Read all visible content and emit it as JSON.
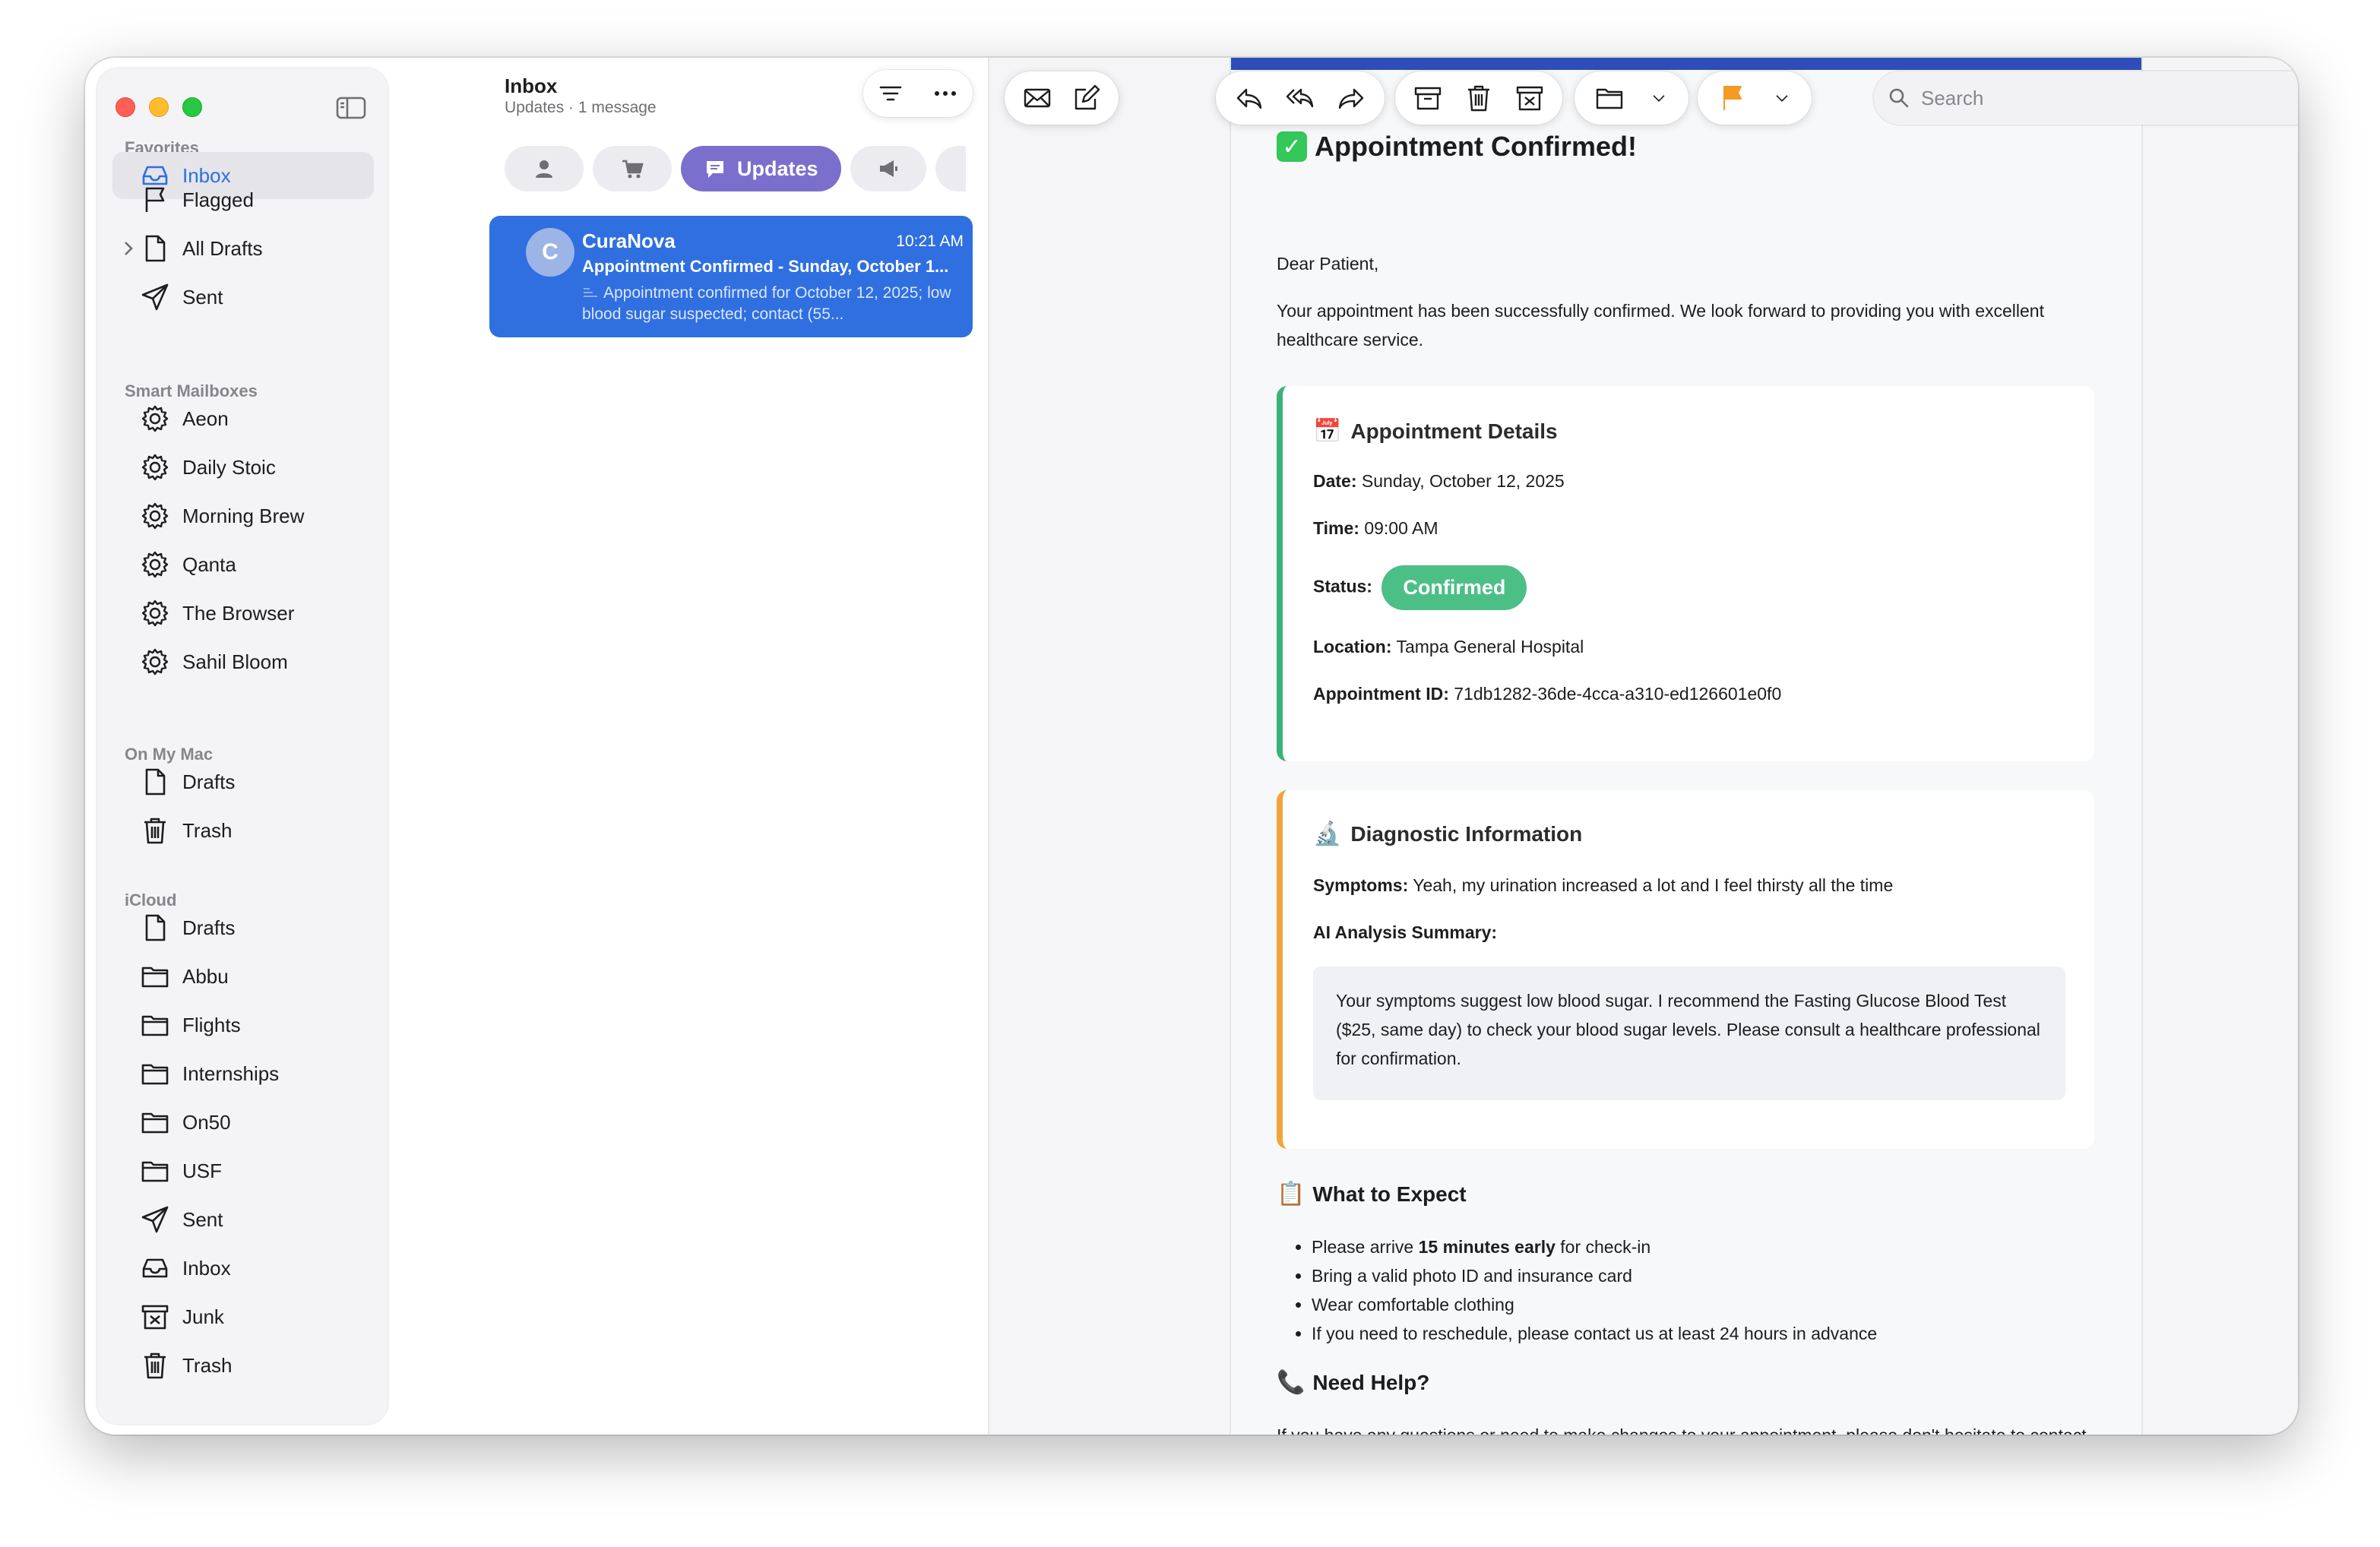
{
  "sidebar": {
    "sections": {
      "favorites": "Favorites",
      "smart": "Smart Mailboxes",
      "onmymac": "On My Mac",
      "icloud": "iCloud"
    },
    "favorites": [
      {
        "label": "Inbox",
        "icon": "inbox-icon"
      },
      {
        "label": "Flagged",
        "icon": "flag-icon"
      },
      {
        "label": "All Drafts",
        "icon": "document-icon"
      },
      {
        "label": "Sent",
        "icon": "paper-plane-icon"
      }
    ],
    "smart": [
      {
        "label": "Aeon",
        "icon": "gear-icon"
      },
      {
        "label": "Daily Stoic",
        "icon": "gear-icon"
      },
      {
        "label": "Morning Brew",
        "icon": "gear-icon"
      },
      {
        "label": "Qanta",
        "icon": "gear-icon"
      },
      {
        "label": "The Browser",
        "icon": "gear-icon"
      },
      {
        "label": "Sahil Bloom",
        "icon": "gear-icon"
      }
    ],
    "onmymac": [
      {
        "label": "Drafts",
        "icon": "document-icon"
      },
      {
        "label": "Trash",
        "icon": "trash-icon"
      }
    ],
    "icloud": [
      {
        "label": "Drafts",
        "icon": "document-icon"
      },
      {
        "label": "Abbu",
        "icon": "folder-icon"
      },
      {
        "label": "Flights",
        "icon": "folder-icon"
      },
      {
        "label": "Internships",
        "icon": "folder-icon"
      },
      {
        "label": "On50",
        "icon": "folder-icon"
      },
      {
        "label": "USF",
        "icon": "folder-icon"
      },
      {
        "label": "Sent",
        "icon": "paper-plane-icon"
      },
      {
        "label": "Inbox",
        "icon": "inbox-icon"
      },
      {
        "label": "Junk",
        "icon": "junk-icon"
      },
      {
        "label": "Trash",
        "icon": "trash-icon"
      }
    ]
  },
  "list": {
    "title": "Inbox",
    "subtitle": "Updates · 1 message",
    "active_category": "Updates",
    "message": {
      "avatar_letter": "C",
      "from": "CuraNova",
      "time": "10:21 AM",
      "subject": "Appointment Confirmed - Sunday, October 1...",
      "preview": "Appointment confirmed for October 12, 2025; low blood sugar suspected; contact (55..."
    }
  },
  "search": {
    "placeholder": "Search"
  },
  "email": {
    "title": "Appointment Confirmed!",
    "greeting": "Dear Patient,",
    "intro": "Your appointment has been successfully confirmed. We look forward to providing you with excellent healthcare service.",
    "details": {
      "heading": "Appointment Details",
      "date_label": "Date:",
      "date": "Sunday, October 12, 2025",
      "time_label": "Time:",
      "time": "09:00 AM",
      "status_label": "Status:",
      "status": "Confirmed",
      "location_label": "Location:",
      "location": "Tampa General Hospital",
      "id_label": "Appointment ID:",
      "id": "71db1282-36de-4cca-a310-ed126601e0f0"
    },
    "diagnostic": {
      "heading": "Diagnostic Information",
      "symptoms_label": "Symptoms:",
      "symptoms": "Yeah, my urination increased a lot and I feel thirsty all the time",
      "ai_label": "AI Analysis Summary:",
      "ai_summary": "Your symptoms suggest low blood sugar. I recommend the Fasting Glucose Blood Test ($25, same day) to check your blood sugar levels. Please consult a healthcare professional for confirmation."
    },
    "expect": {
      "heading": "What to Expect",
      "item1_pre": "Please arrive ",
      "item1_bold": "15 minutes early",
      "item1_post": " for check-in",
      "item2": "Bring a valid photo ID and insurance card",
      "item3": "Wear comfortable clothing",
      "item4": "If you need to reschedule, please contact us at least 24 hours in advance"
    },
    "help": {
      "heading": "Need Help?",
      "text": "If you have any questions or need to make changes to your appointment, please don't hesitate to contact us:"
    }
  },
  "colors": {
    "accent": "#2f6fe0",
    "updates_pill": "#7a6fcd",
    "status_green": "#4cbf86",
    "card_green": "#3ab37a",
    "card_orange": "#f0a53a",
    "flag_orange": "#f59a23",
    "email_band": "#2f4db8"
  }
}
